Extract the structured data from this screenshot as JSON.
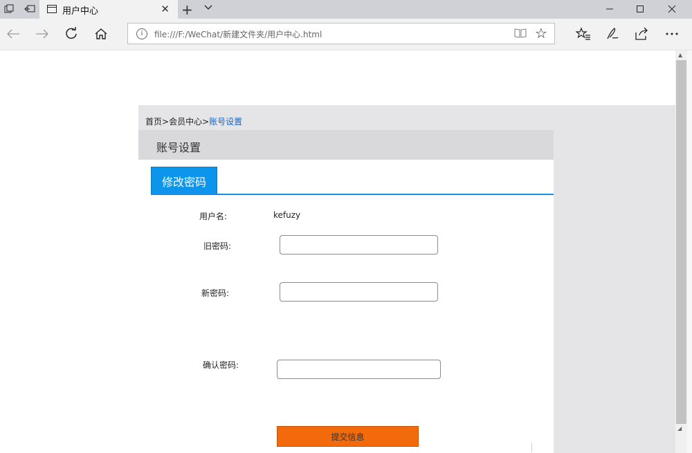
{
  "browser": {
    "tab_title": "用户中心",
    "url": "file:///F:/WeChat/新建文件夹/用户中心.html",
    "icons": [
      "tab-manager-icon",
      "set-aside-tabs-icon",
      "page-icon",
      "close-icon",
      "new-tab-icon",
      "chevron-down-icon",
      "back-icon",
      "forward-icon",
      "refresh-icon",
      "home-icon",
      "info-icon",
      "reading-view-icon",
      "favorite-star-icon",
      "favorites-icon",
      "pen-icon",
      "share-icon",
      "more-icon",
      "minimize-icon",
      "maximize-icon",
      "close-window-icon"
    ]
  },
  "breadcrumb": {
    "home": "首页",
    "sep1": ">",
    "member": "会员中心",
    "sep2": ">",
    "current": "账号设置"
  },
  "panel": {
    "title": "账号设置",
    "tab_label": "修改密码"
  },
  "form": {
    "username_label": "用户名:",
    "username_value": "kefuzy",
    "old_password_label": "旧密码:",
    "new_password_label": "新密码:",
    "confirm_password_label": "确认密码:",
    "submit_label": "提交信息"
  },
  "colors": {
    "tab_active": "#0d95ec",
    "submit_button": "#f26a0b",
    "breadcrumb_active": "#1a66c8"
  }
}
